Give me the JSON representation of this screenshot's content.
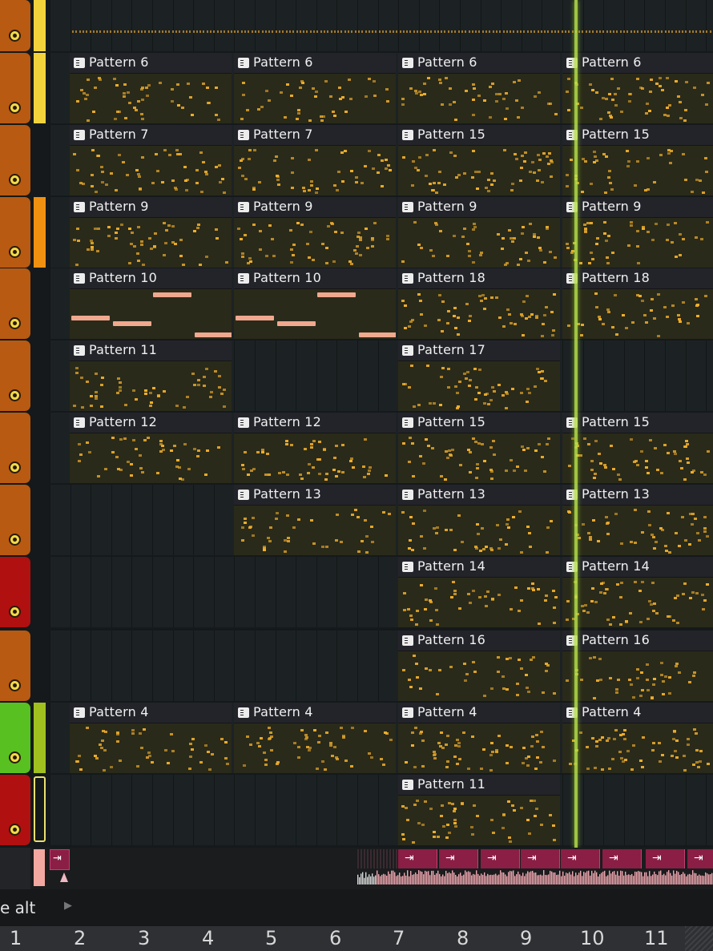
{
  "tracks": [
    {
      "color": "#b85a12",
      "strip": "#f3d33c",
      "clips": []
    },
    {
      "color": "#b85a12",
      "strip": "#f3d33c",
      "clips": [
        {
          "col": 0,
          "label": "Pattern 6"
        },
        {
          "col": 1,
          "label": "Pattern 6"
        },
        {
          "col": 2,
          "label": "Pattern 6"
        },
        {
          "col": 3,
          "label": "Pattern 6"
        }
      ]
    },
    {
      "color": "#b85a12",
      "strip": "",
      "clips": [
        {
          "col": 0,
          "label": "Pattern 7"
        },
        {
          "col": 1,
          "label": "Pattern 7"
        },
        {
          "col": 2,
          "label": "Pattern 15"
        },
        {
          "col": 3,
          "label": "Pattern 15"
        }
      ]
    },
    {
      "color": "#b85a12",
      "strip": "#f09010",
      "clips": [
        {
          "col": 0,
          "label": "Pattern 9"
        },
        {
          "col": 1,
          "label": "Pattern 9"
        },
        {
          "col": 2,
          "label": "Pattern 9"
        },
        {
          "col": 3,
          "label": "Pattern 9"
        }
      ]
    },
    {
      "color": "#b85a12",
      "strip": "",
      "clips": [
        {
          "col": 0,
          "label": "Pattern 10"
        },
        {
          "col": 1,
          "label": "Pattern 10"
        },
        {
          "col": 2,
          "label": "Pattern 18"
        },
        {
          "col": 3,
          "label": "Pattern 18"
        }
      ]
    },
    {
      "color": "#b85a12",
      "strip": "",
      "clips": [
        {
          "col": 0,
          "label": "Pattern 11"
        },
        {
          "col": 2,
          "label": "Pattern 17"
        }
      ]
    },
    {
      "color": "#b85a12",
      "strip": "",
      "clips": [
        {
          "col": 0,
          "label": "Pattern 12"
        },
        {
          "col": 1,
          "label": "Pattern 12"
        },
        {
          "col": 2,
          "label": "Pattern 15"
        },
        {
          "col": 3,
          "label": "Pattern 15"
        }
      ]
    },
    {
      "color": "#b85a12",
      "strip": "",
      "clips": [
        {
          "col": 1,
          "label": "Pattern 13"
        },
        {
          "col": 2,
          "label": "Pattern 13"
        },
        {
          "col": 3,
          "label": "Pattern 13"
        }
      ]
    },
    {
      "color": "#b01010",
      "strip": "",
      "clips": [
        {
          "col": 2,
          "label": "Pattern 14"
        },
        {
          "col": 3,
          "label": "Pattern 14"
        }
      ]
    },
    {
      "color": "#b85a12",
      "strip": "",
      "clips": [
        {
          "col": 2,
          "label": "Pattern 16"
        },
        {
          "col": 3,
          "label": "Pattern 16"
        }
      ]
    },
    {
      "color": "#58c020",
      "strip": "#a0c020",
      "clips": [
        {
          "col": 0,
          "label": "Pattern 4"
        },
        {
          "col": 1,
          "label": "Pattern 4"
        },
        {
          "col": 2,
          "label": "Pattern 4"
        },
        {
          "col": 3,
          "label": "Pattern 4"
        }
      ]
    },
    {
      "color": "#b01010",
      "strip": "outline",
      "clips": [
        {
          "col": 2,
          "label": "Pattern 11"
        }
      ]
    }
  ],
  "track_name_fragment": "e alt",
  "bar_numbers": [
    "1",
    "2",
    "3",
    "4",
    "5",
    "6",
    "7",
    "8",
    "9",
    "10",
    "11"
  ],
  "colors": {
    "note": "#f2b02c",
    "note_bar": "#f0a88e",
    "playhead": "#b8e04a",
    "audio_clip": "#8a1e44",
    "waveform": "#f0a8b0"
  },
  "icons": {
    "clip": "pattern-clip-icon",
    "mute": "mute-toggle-icon",
    "audio": "audio-slice-marker-icon",
    "arrow": "chevron-right-icon"
  }
}
